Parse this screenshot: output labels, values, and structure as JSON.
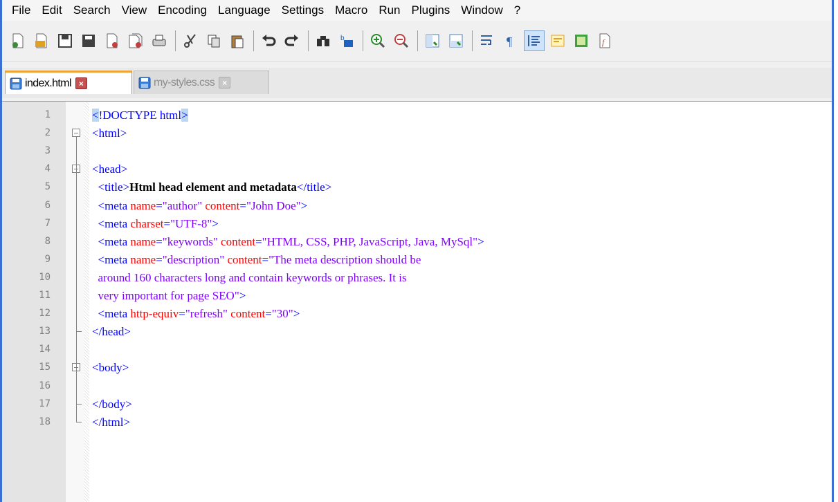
{
  "menu": [
    "File",
    "Edit",
    "Search",
    "View",
    "Encoding",
    "Language",
    "Settings",
    "Macro",
    "Run",
    "Plugins",
    "Window",
    "?"
  ],
  "toolbar": [
    {
      "name": "new-file-icon",
      "color": "#3c8a3a"
    },
    {
      "name": "open-file-icon",
      "color": "#e0a020"
    },
    {
      "name": "save-icon",
      "color": "#404040"
    },
    {
      "name": "save-all-icon",
      "color": "#404040"
    },
    {
      "name": "close-icon",
      "color": "#c04040"
    },
    {
      "name": "close-all-icon",
      "color": "#c04040"
    },
    {
      "name": "print-icon",
      "color": "#404040"
    },
    "sep",
    {
      "name": "cut-icon",
      "color": "#404040"
    },
    {
      "name": "copy-icon",
      "color": "#404040"
    },
    {
      "name": "paste-icon",
      "color": "#404040"
    },
    "sep",
    {
      "name": "undo-icon",
      "color": "#303030"
    },
    {
      "name": "redo-icon",
      "color": "#303030"
    },
    "sep",
    {
      "name": "find-icon",
      "color": "#303030"
    },
    {
      "name": "replace-icon",
      "color": "#2060c0"
    },
    "sep",
    {
      "name": "zoom-in-icon",
      "color": "#2a8a2a"
    },
    {
      "name": "zoom-out-icon",
      "color": "#c04040"
    },
    "sep",
    {
      "name": "sync-vertical-icon",
      "color": "#5080c0"
    },
    {
      "name": "sync-horizontal-icon",
      "color": "#5080c0"
    },
    "sep",
    {
      "name": "word-wrap-icon",
      "color": "#3060a0"
    },
    {
      "name": "show-all-chars-icon",
      "color": "#3060a0"
    },
    {
      "name": "indent-guide-icon",
      "color": "#3060a0"
    },
    {
      "name": "user-language-icon",
      "color": "#e0a020"
    },
    {
      "name": "doc-map-icon",
      "color": "#40a040"
    },
    {
      "name": "function-list-icon",
      "color": "#c04040"
    }
  ],
  "tabs": [
    {
      "label": "index.html",
      "active": true
    },
    {
      "label": "my-styles.css",
      "active": false
    }
  ],
  "colors": {
    "tag": "#0000ff",
    "attribute": "#ff0000",
    "string": "#8000ff",
    "active_tab_accent": "#f0a53a",
    "window_border": "#3b6fd4"
  },
  "lines": [
    {
      "n": "1",
      "tokens": [
        [
          "hl",
          "<"
        ],
        [
          "tag",
          "!DOCTYPE html"
        ],
        [
          "hl",
          ">"
        ]
      ]
    },
    {
      "n": "2",
      "tokens": [
        [
          "tag",
          "<html>"
        ]
      ]
    },
    {
      "n": "3",
      "tokens": []
    },
    {
      "n": "4",
      "tokens": [
        [
          "tag",
          "<head>"
        ]
      ]
    },
    {
      "n": "5",
      "tokens": [
        [
          "tag",
          "  <title>"
        ],
        [
          "txt",
          "Html head element and metadata"
        ],
        [
          "tag",
          "</title>"
        ]
      ]
    },
    {
      "n": "6",
      "tokens": [
        [
          "tag",
          "  <meta "
        ],
        [
          "attr",
          "name"
        ],
        [
          "tag",
          "="
        ],
        [
          "str",
          "\"author\""
        ],
        [
          "tag",
          " "
        ],
        [
          "attr",
          "content"
        ],
        [
          "tag",
          "="
        ],
        [
          "str",
          "\"John Doe\""
        ],
        [
          "tag",
          ">"
        ]
      ]
    },
    {
      "n": "7",
      "tokens": [
        [
          "tag",
          "  <meta "
        ],
        [
          "attr",
          "charset"
        ],
        [
          "tag",
          "="
        ],
        [
          "str",
          "\"UTF-8\""
        ],
        [
          "tag",
          ">"
        ]
      ]
    },
    {
      "n": "8",
      "tokens": [
        [
          "tag",
          "  <meta "
        ],
        [
          "attr",
          "name"
        ],
        [
          "tag",
          "="
        ],
        [
          "str",
          "\"keywords\""
        ],
        [
          "tag",
          " "
        ],
        [
          "attr",
          "content"
        ],
        [
          "tag",
          "="
        ],
        [
          "str",
          "\"HTML, CSS, PHP, JavaScript, Java, MySql\""
        ],
        [
          "tag",
          ">"
        ]
      ]
    },
    {
      "n": "9",
      "tokens": [
        [
          "tag",
          "  <meta "
        ],
        [
          "attr",
          "name"
        ],
        [
          "tag",
          "="
        ],
        [
          "str",
          "\"description\""
        ],
        [
          "tag",
          " "
        ],
        [
          "attr",
          "content"
        ],
        [
          "tag",
          "="
        ],
        [
          "str",
          "\"The meta description should be"
        ]
      ]
    },
    {
      "n": "10",
      "tokens": [
        [
          "str",
          "  around 160 characters long and contain keywords or phrases. It is"
        ]
      ]
    },
    {
      "n": "11",
      "tokens": [
        [
          "str",
          "  very important for page SEO\""
        ],
        [
          "tag",
          ">"
        ]
      ]
    },
    {
      "n": "12",
      "tokens": [
        [
          "tag",
          "  <meta "
        ],
        [
          "attr",
          "http-equiv"
        ],
        [
          "tag",
          "="
        ],
        [
          "str",
          "\"refresh\""
        ],
        [
          "tag",
          " "
        ],
        [
          "attr",
          "content"
        ],
        [
          "tag",
          "="
        ],
        [
          "str",
          "\"30\""
        ],
        [
          "tag",
          ">"
        ]
      ]
    },
    {
      "n": "13",
      "tokens": [
        [
          "tag",
          "</head>"
        ]
      ]
    },
    {
      "n": "14",
      "tokens": []
    },
    {
      "n": "15",
      "tokens": [
        [
          "tag",
          "<body>"
        ]
      ]
    },
    {
      "n": "16",
      "tokens": []
    },
    {
      "n": "17",
      "tokens": [
        [
          "tag",
          "</body>"
        ]
      ]
    },
    {
      "n": "18",
      "tokens": [
        [
          "tag",
          "</html>"
        ]
      ]
    }
  ]
}
